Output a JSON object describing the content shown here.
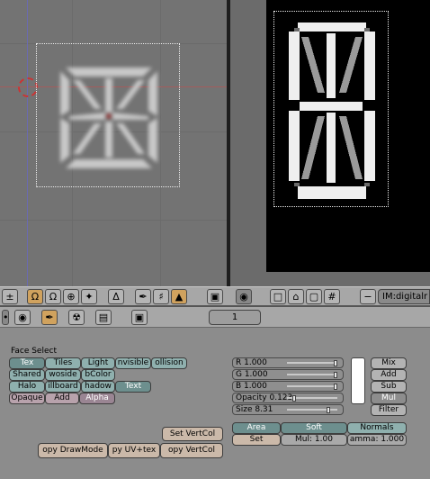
{
  "left_view": {
    "name": "3d-viewport"
  },
  "right_view": {
    "name": "image-editor"
  },
  "header": {
    "image_name": "IM:digitalr",
    "pin_symbol": "±",
    "minus_symbol": "−"
  },
  "buttons_header": {
    "frame": "1"
  },
  "panel": {
    "face_select_label": "Face Select",
    "row1": [
      "Tex",
      "Tiles",
      "Light",
      "nvisible",
      "ollision"
    ],
    "row2": [
      "Shared",
      "woside",
      "bColor"
    ],
    "row3": [
      "Halo",
      "illboard",
      "hadow",
      "Text"
    ],
    "row4": [
      "Opaque",
      "Add",
      "Alpha"
    ],
    "set_vertcol": "Set VertCol",
    "copy_drawmode": "opy DrawMode",
    "copy_uvtex": "py UV+tex",
    "copy_vertcol": "opy VertCol",
    "sliders": [
      {
        "label": "R 1.000",
        "value": 1.0
      },
      {
        "label": "G 1.000",
        "value": 1.0
      },
      {
        "label": "B 1.000",
        "value": 1.0
      },
      {
        "label": "Opacity 0.123",
        "value": 0.123
      },
      {
        "label": "Size 8.31",
        "value": 0.83
      }
    ],
    "blend": [
      "Mix",
      "Add",
      "Sub",
      "Mul",
      "Filter"
    ],
    "mode_row": [
      "Area",
      "Soft",
      "Normals"
    ],
    "set_label": "Set",
    "mul_field": "Mul: 1.00",
    "gamma_field": "amma: 1.000"
  },
  "colors": {
    "accent": "#d0a25e",
    "teal_button": "#8fb0ae",
    "pink_button": "#b8a2ac"
  }
}
